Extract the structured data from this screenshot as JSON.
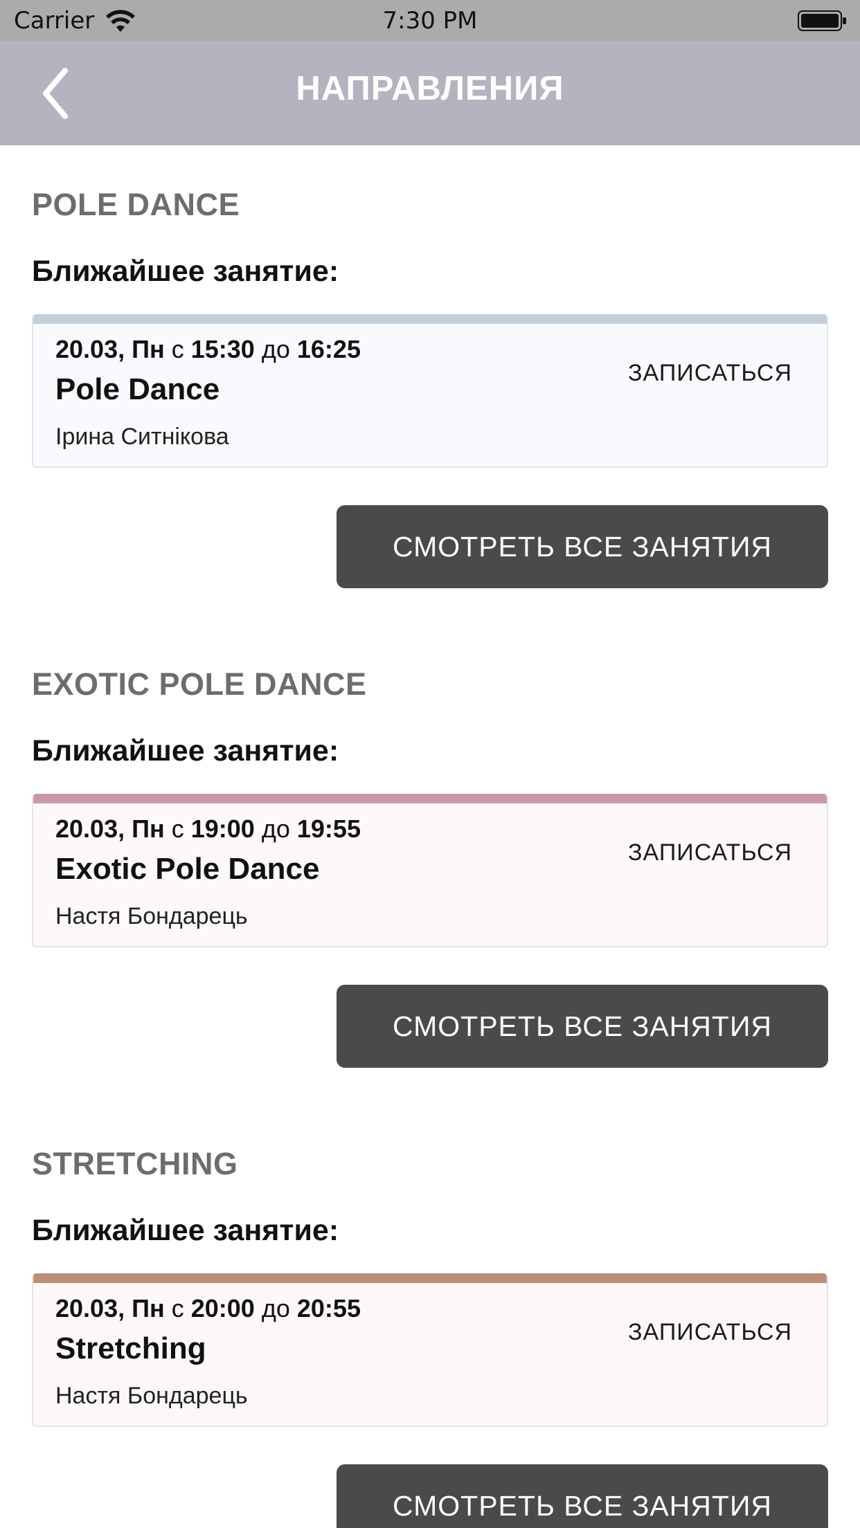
{
  "status_bar": {
    "carrier": "Carrier",
    "time": "7:30 PM"
  },
  "nav": {
    "title": "НАПРАВЛЕНИЯ"
  },
  "sections": [
    {
      "title": "POLE DANCE",
      "next_label": "Ближайшее занятие:",
      "accent_color": "#c5cedd",
      "card_bg": "#f8fafd",
      "lesson": {
        "date": "20.03, Пн",
        "from_word": "с",
        "start": "15:30",
        "to_word": "до",
        "end": "16:25",
        "name": "Pole Dance",
        "coach": "Ірина Ситнікова",
        "signup_label": "ЗАПИСАТЬСЯ"
      },
      "all_button_label": "СМОТРЕТЬ ВСЕ ЗАНЯТИЯ"
    },
    {
      "title": "EXOTIC POLE DANCE",
      "next_label": "Ближайшее занятие:",
      "accent_color": "#cc9aa6",
      "card_bg": "#fdf8f9",
      "lesson": {
        "date": "20.03, Пн",
        "from_word": "с",
        "start": "19:00",
        "to_word": "до",
        "end": "19:55",
        "name": "Exotic Pole Dance",
        "coach": "Настя Бондарець",
        "signup_label": "ЗАПИСАТЬСЯ"
      },
      "all_button_label": "СМОТРЕТЬ ВСЕ ЗАНЯТИЯ"
    },
    {
      "title": "STRETCHING",
      "next_label": "Ближайшее занятие:",
      "accent_color": "#bb8e78",
      "card_bg": "#fcf8f7",
      "lesson": {
        "date": "20.03, Пн",
        "from_word": "с",
        "start": "20:00",
        "to_word": "до",
        "end": "20:55",
        "name": "Stretching",
        "coach": "Настя Бондарець",
        "signup_label": "ЗАПИСАТЬСЯ"
      },
      "all_button_label": "СМОТРЕТЬ ВСЕ ЗАНЯТИЯ"
    }
  ],
  "icons": {
    "back": "chevron-left-icon",
    "wifi": "wifi-icon",
    "battery": "battery-icon"
  }
}
